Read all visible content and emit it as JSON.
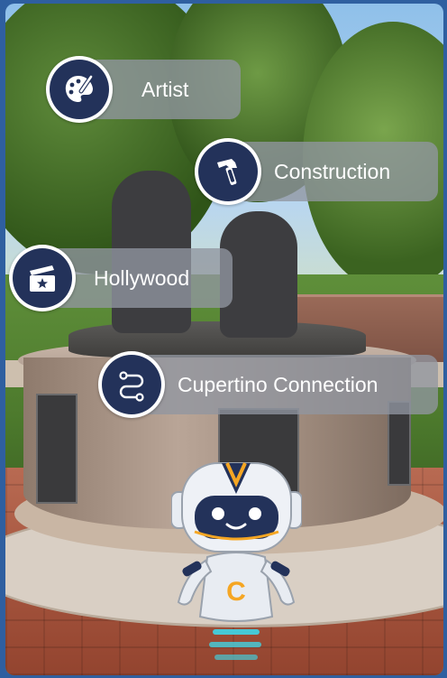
{
  "menu": {
    "items": [
      {
        "label": "Artist",
        "icon": "palette-icon"
      },
      {
        "label": "Construction",
        "icon": "hammer-icon"
      },
      {
        "label": "Hollywood",
        "icon": "clapperboard-star-icon"
      },
      {
        "label": "Cupertino Connection",
        "icon": "route-path-icon"
      }
    ]
  },
  "mascot": {
    "badge_letter": "C"
  },
  "colors": {
    "chip_bg": "#9196a0",
    "icon_circle": "#23325a",
    "mascot_accent": "#f5a623",
    "mascot_visor": "#23325a"
  }
}
